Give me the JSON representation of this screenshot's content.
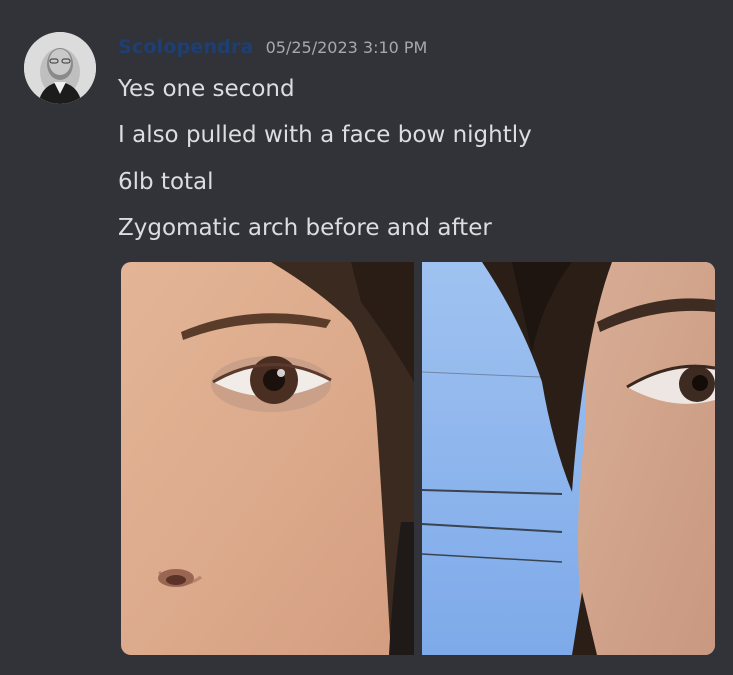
{
  "message": {
    "author": "Scolopendra",
    "timestamp": "05/25/2023 3:10 PM",
    "lines": [
      "Yes one second",
      "I also pulled with a face bow nightly",
      "6lb total",
      "Zygomatic arch before and after"
    ],
    "attachments": [
      {
        "kind": "photo",
        "subject": "before photo - close-up of eye and nose"
      },
      {
        "kind": "photo",
        "subject": "after photo - close-up of eye and cheek against blue sky"
      }
    ]
  },
  "colors": {
    "background": "#313338",
    "username": "#1e3f73",
    "timestamp": "#a6a9b0",
    "text": "#dbdee1"
  }
}
